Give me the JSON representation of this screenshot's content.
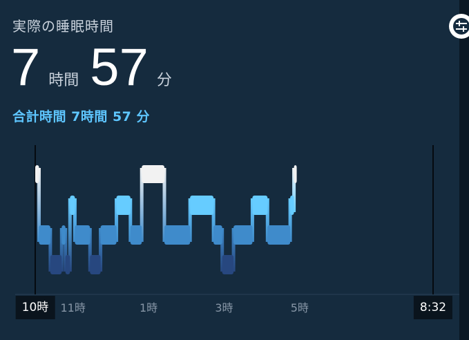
{
  "header": {
    "title": "実際の睡眠時間",
    "hours": "7",
    "hours_unit": "時間",
    "minutes": "57",
    "minutes_unit": "分",
    "total_text": "合計時間 7時間 57 分"
  },
  "icons": {
    "filter": "filter-sliders-icon"
  },
  "colors": {
    "card": "#152b3e",
    "awake": "#f2f2f2",
    "rem": "#66ccff",
    "core": "#3f8bcb",
    "deep": "#27477f",
    "accent_text": "#5ec6ff"
  },
  "chart_data": {
    "type": "step",
    "x_unit": "hours since 22:00",
    "x_range": [
      0,
      10.5333
    ],
    "stages": [
      "awake",
      "rem",
      "core",
      "deep"
    ],
    "segments": [
      {
        "start": 0.0,
        "end": 0.1,
        "stage": "awake"
      },
      {
        "start": 0.1,
        "end": 0.4,
        "stage": "core"
      },
      {
        "start": 0.4,
        "end": 0.7,
        "stage": "deep"
      },
      {
        "start": 0.7,
        "end": 0.8,
        "stage": "core"
      },
      {
        "start": 0.8,
        "end": 0.92,
        "stage": "deep"
      },
      {
        "start": 0.92,
        "end": 1.05,
        "stage": "rem"
      },
      {
        "start": 1.05,
        "end": 1.45,
        "stage": "core"
      },
      {
        "start": 1.45,
        "end": 1.73,
        "stage": "deep"
      },
      {
        "start": 1.73,
        "end": 2.15,
        "stage": "core"
      },
      {
        "start": 2.15,
        "end": 2.52,
        "stage": "rem"
      },
      {
        "start": 2.52,
        "end": 2.82,
        "stage": "core"
      },
      {
        "start": 2.82,
        "end": 3.42,
        "stage": "awake"
      },
      {
        "start": 3.42,
        "end": 4.1,
        "stage": "core"
      },
      {
        "start": 4.1,
        "end": 4.72,
        "stage": "rem"
      },
      {
        "start": 4.72,
        "end": 4.95,
        "stage": "core"
      },
      {
        "start": 4.95,
        "end": 5.25,
        "stage": "deep"
      },
      {
        "start": 5.25,
        "end": 5.75,
        "stage": "core"
      },
      {
        "start": 5.75,
        "end": 6.15,
        "stage": "rem"
      },
      {
        "start": 6.15,
        "end": 6.75,
        "stage": "core"
      },
      {
        "start": 6.75,
        "end": 6.85,
        "stage": "rem"
      },
      {
        "start": 6.85,
        "end": 6.92,
        "stage": "awake"
      }
    ],
    "x_ticks": [
      {
        "value": 0,
        "label": "10時",
        "emphasis": true
      },
      {
        "value": 1,
        "label": "11時"
      },
      {
        "value": 3,
        "label": "1時"
      },
      {
        "value": 5,
        "label": "3時"
      },
      {
        "value": 7,
        "label": "5時"
      },
      {
        "value": 10.5333,
        "label": "8:32",
        "emphasis": true
      }
    ]
  }
}
